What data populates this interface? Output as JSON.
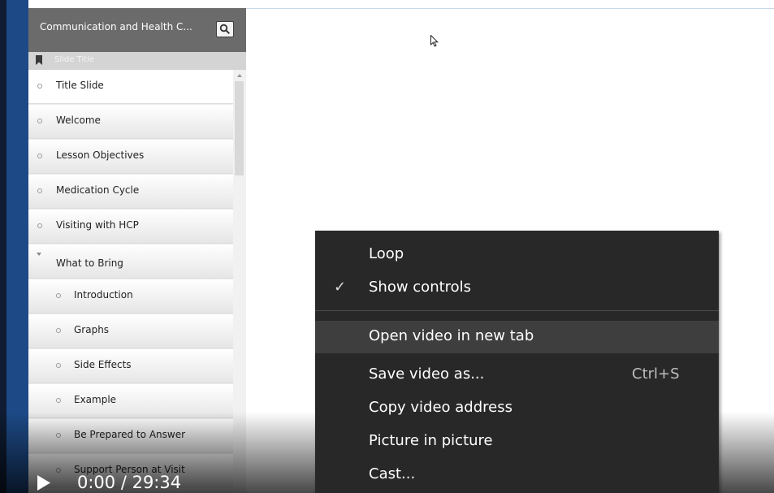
{
  "sidebar": {
    "title": "Communication and Health C...",
    "column_header": "Slide Title",
    "items": [
      {
        "label": "Title Slide",
        "level": 1
      },
      {
        "label": "Welcome",
        "level": 1
      },
      {
        "label": "Lesson Objectives",
        "level": 1
      },
      {
        "label": "Medication Cycle",
        "level": 1
      },
      {
        "label": "Visiting with HCP",
        "level": 1
      },
      {
        "label": "What to Bring",
        "level": 1,
        "expanded": true
      },
      {
        "label": "Introduction",
        "level": 2
      },
      {
        "label": "Graphs",
        "level": 2
      },
      {
        "label": "Side Effects",
        "level": 2
      },
      {
        "label": "Example",
        "level": 2
      },
      {
        "label": "Be Prepared to Answer",
        "level": 2
      },
      {
        "label": "Support Person at Visit",
        "level": 2
      }
    ]
  },
  "player": {
    "time": "0:00 / 29:34"
  },
  "context_menu": {
    "items": [
      {
        "label": "Loop",
        "checked": false,
        "shortcut": "",
        "highlighted": false
      },
      {
        "label": "Show controls",
        "checked": true,
        "shortcut": "",
        "highlighted": false
      },
      {
        "label": "Open video in new tab",
        "checked": false,
        "shortcut": "",
        "highlighted": true
      },
      {
        "label": "Save video as...",
        "checked": false,
        "shortcut": "Ctrl+S",
        "highlighted": false
      },
      {
        "label": "Copy video address",
        "checked": false,
        "shortcut": "",
        "highlighted": false
      },
      {
        "label": "Picture in picture",
        "checked": false,
        "shortcut": "",
        "highlighted": false
      },
      {
        "label": "Cast...",
        "checked": false,
        "shortcut": "",
        "highlighted": false
      }
    ],
    "check_glyph": "✓"
  },
  "colors": {
    "sidebar_accent": "#1d4a87",
    "header_gray": "#6b6b6b",
    "menu_bg": "#282828",
    "menu_highlight": "#3e3e3e"
  },
  "icons": [
    "search-icon",
    "bookmark-icon",
    "play-icon",
    "checkmark-icon",
    "mouse-cursor-icon"
  ]
}
